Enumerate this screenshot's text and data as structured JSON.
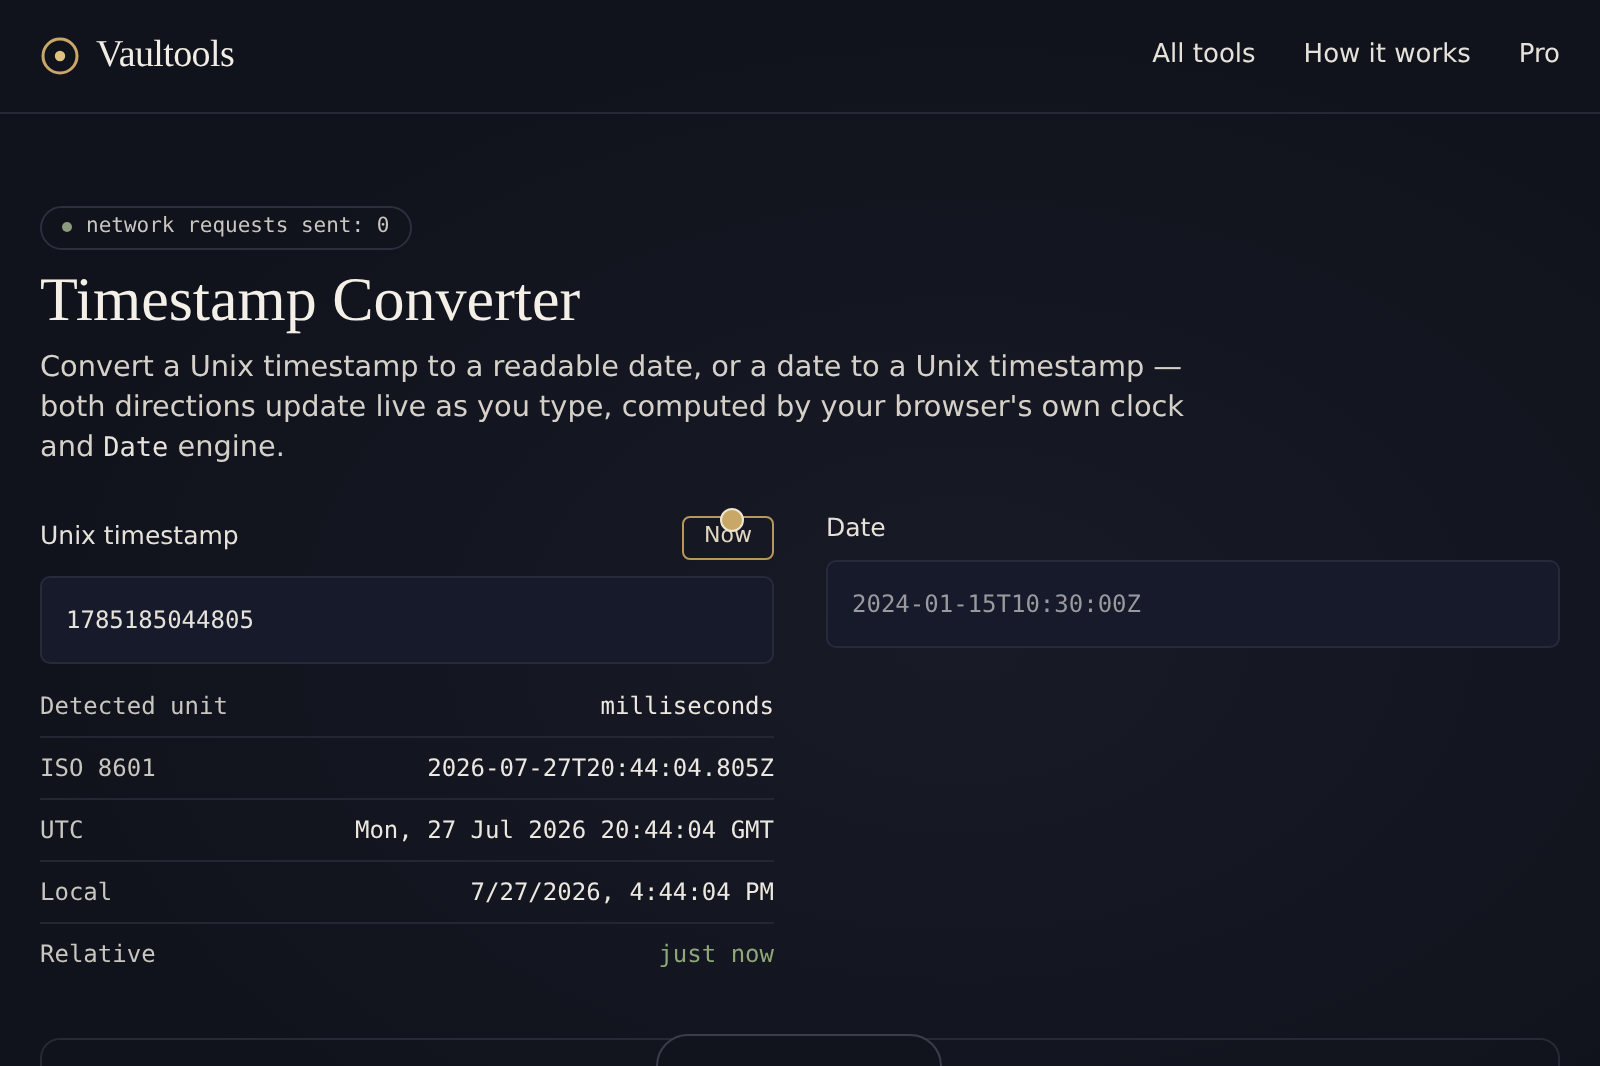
{
  "brand": {
    "name": "Vaultools"
  },
  "nav": [
    {
      "label": "All tools"
    },
    {
      "label": "How it works"
    },
    {
      "label": "Pro"
    }
  ],
  "status_badge": {
    "text": "network requests sent: 0"
  },
  "title": "Timestamp Converter",
  "description": [
    {
      "kind": "text",
      "text": "Convert a Unix timestamp to a readable date, or a date to a Unix timestamp — both directions update live as you type, computed by your browser's own clock and "
    },
    {
      "kind": "code",
      "text": "Date"
    },
    {
      "kind": "text",
      "text": " engine."
    }
  ],
  "unix_panel": {
    "label": "Unix timestamp",
    "button": "Now",
    "value": "1785185044805"
  },
  "date_panel": {
    "label": "Date",
    "placeholder": "2024-01-15T10:30:00Z"
  },
  "results": [
    {
      "label": "Detected unit",
      "value": "milliseconds",
      "highlight": false
    },
    {
      "label": "ISO 8601",
      "value": "2026-07-27T20:44:04.805Z",
      "highlight": false
    },
    {
      "label": "UTC",
      "value": "Mon, 27 Jul 2026 20:44:04 GMT",
      "highlight": false
    },
    {
      "label": "Local",
      "value": "7/27/2026, 4:44:04 PM",
      "highlight": false
    },
    {
      "label": "Relative",
      "value": "just now",
      "highlight": true
    }
  ]
}
